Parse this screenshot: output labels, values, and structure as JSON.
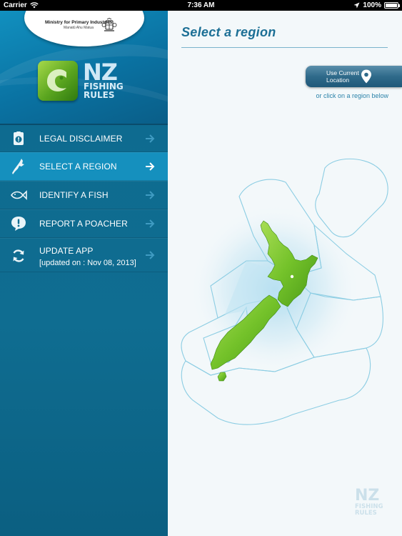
{
  "status_bar": {
    "carrier": "Carrier",
    "time": "7:36 AM",
    "battery": "100%",
    "battery_level": 1.0
  },
  "sidebar": {
    "ministry": {
      "name": "Ministry for Primary Industries",
      "maori": "Manatū Ahu Matua"
    },
    "logo": {
      "nz": "NZ",
      "line1": "FISHING",
      "line2": "RULES"
    },
    "menu": [
      {
        "label": "LEGAL DISCLAIMER",
        "icon": "disclaimer-icon"
      },
      {
        "label": "SELECT A REGION",
        "icon": "region-icon",
        "active": true
      },
      {
        "label": "IDENTIFY A FISH",
        "icon": "fish-icon"
      },
      {
        "label": "REPORT A POACHER",
        "icon": "alert-icon"
      },
      {
        "label": "UPDATE APP",
        "sublabel": "[updated on : Nov 08, 2013]",
        "icon": "refresh-icon"
      }
    ]
  },
  "main": {
    "title": "Select a region",
    "location_button": {
      "line1": "Use Current",
      "line2": "Location"
    },
    "hint": "or click on a region below",
    "watermark": {
      "nz": "NZ",
      "line1": "FISHING",
      "line2": "RULES"
    }
  },
  "colors": {
    "sidebar_bg": "#0f6d91",
    "active_item": "#1590be",
    "title": "#1c6f95",
    "land_green": "#7cc530",
    "region_outline": "#8ccde3"
  }
}
